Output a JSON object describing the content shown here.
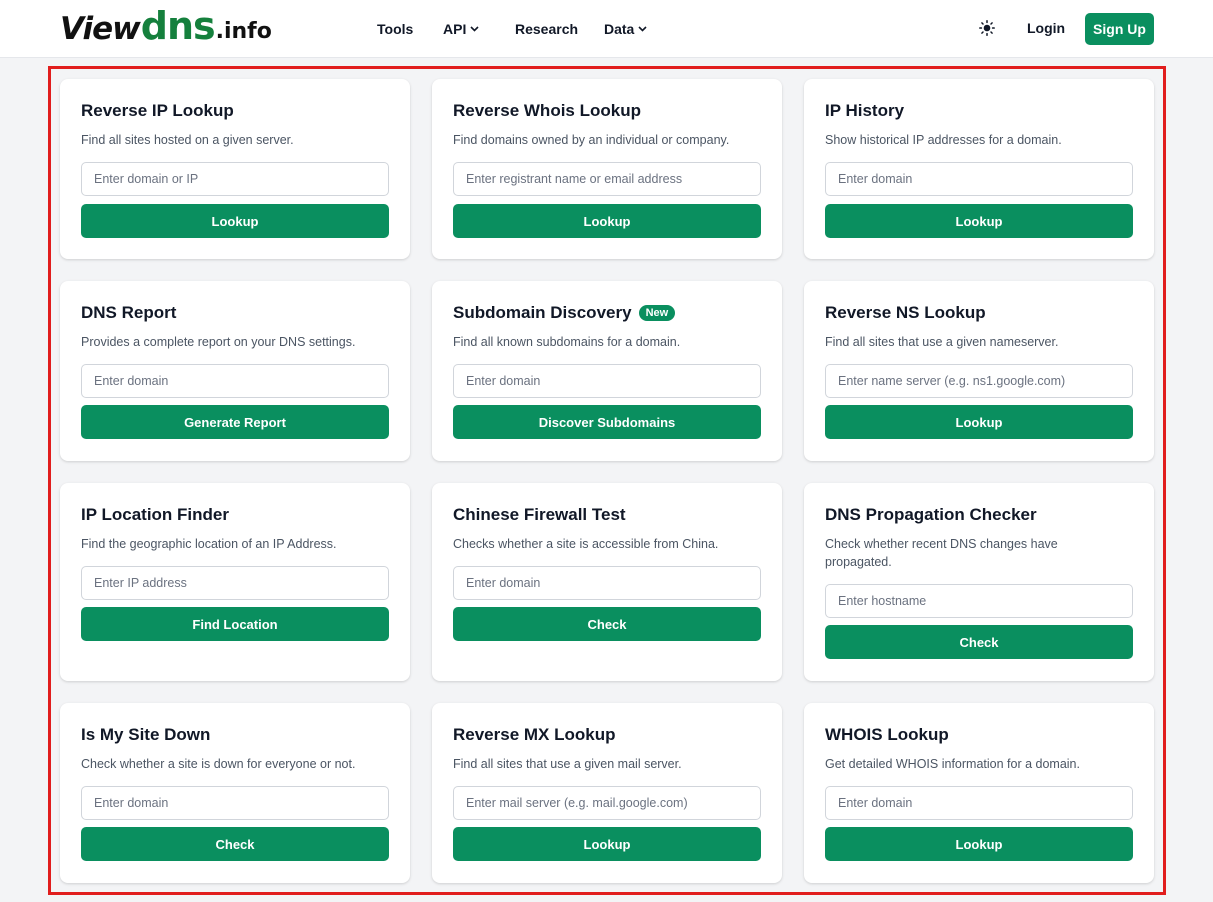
{
  "logo": {
    "part1": "View",
    "part2": "dns",
    "part3": ".info"
  },
  "nav": {
    "tools": "Tools",
    "api": "API",
    "research": "Research",
    "data": "Data",
    "login": "Login",
    "signup": "Sign Up"
  },
  "cards": [
    {
      "title": "Reverse IP Lookup",
      "desc": "Find all sites hosted on a given server.",
      "placeholder": "Enter domain or IP",
      "button": "Lookup"
    },
    {
      "title": "Reverse Whois Lookup",
      "desc": "Find domains owned by an individual or company.",
      "placeholder": "Enter registrant name or email address",
      "button": "Lookup"
    },
    {
      "title": "IP History",
      "desc": "Show historical IP addresses for a domain.",
      "placeholder": "Enter domain",
      "button": "Lookup"
    },
    {
      "title": "DNS Report",
      "desc": "Provides a complete report on your DNS settings.",
      "placeholder": "Enter domain",
      "button": "Generate Report"
    },
    {
      "title": "Subdomain Discovery",
      "badge": "New",
      "desc": "Find all known subdomains for a domain.",
      "placeholder": "Enter domain",
      "button": "Discover Subdomains"
    },
    {
      "title": "Reverse NS Lookup",
      "desc": "Find all sites that use a given nameserver.",
      "placeholder": "Enter name server (e.g. ns1.google.com)",
      "button": "Lookup"
    },
    {
      "title": "IP Location Finder",
      "desc": "Find the geographic location of an IP Address.",
      "placeholder": "Enter IP address",
      "button": "Find Location"
    },
    {
      "title": "Chinese Firewall Test",
      "desc": "Checks whether a site is accessible from China.",
      "placeholder": "Enter domain",
      "button": "Check"
    },
    {
      "title": "DNS Propagation Checker",
      "desc": "Check whether recent DNS changes have propagated.",
      "placeholder": "Enter hostname",
      "button": "Check"
    },
    {
      "title": "Is My Site Down",
      "desc": "Check whether a site is down for everyone or not.",
      "placeholder": "Enter domain",
      "button": "Check"
    },
    {
      "title": "Reverse MX Lookup",
      "desc": "Find all sites that use a given mail server.",
      "placeholder": "Enter mail server (e.g. mail.google.com)",
      "button": "Lookup"
    },
    {
      "title": "WHOIS Lookup",
      "desc": "Get detailed WHOIS information for a domain.",
      "placeholder": "Enter domain",
      "button": "Lookup"
    }
  ],
  "colors": {
    "accent": "#0a8f5f",
    "highlight_frame": "#e11d1d",
    "logo_green": "#15803d"
  },
  "icons": {
    "theme_toggle": "sun-icon",
    "dropdown": "chevron-down-icon"
  }
}
